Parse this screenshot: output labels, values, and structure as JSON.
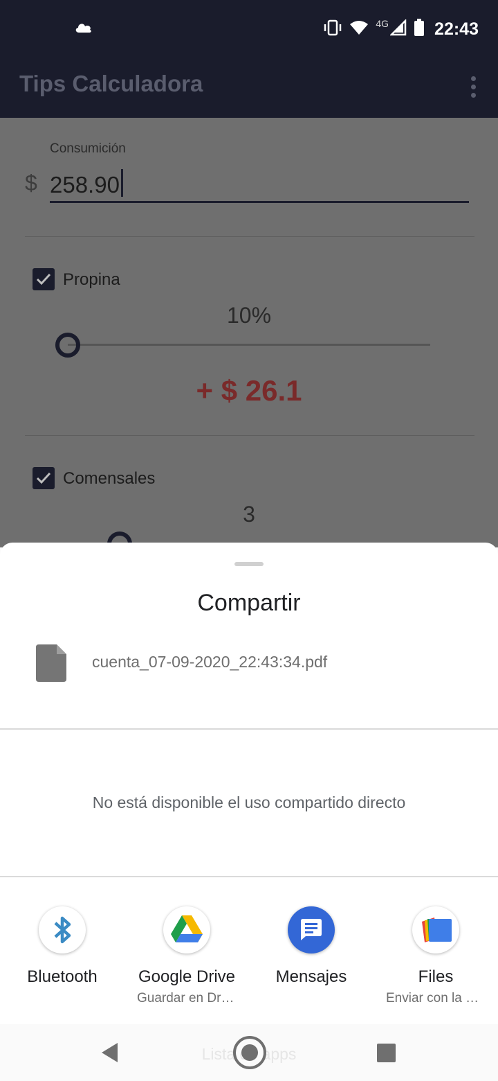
{
  "status_bar": {
    "time": "22:43",
    "network": "4G",
    "icons": [
      "cloud-icon",
      "vibrate-icon",
      "wifi-icon",
      "signal-icon",
      "battery-icon"
    ]
  },
  "app_bar": {
    "title": "Tips Calculadora",
    "menu_icon": "more-vert-icon"
  },
  "form": {
    "consumption_label": "Consumición",
    "currency_symbol": "$",
    "consumption_value": "258.90",
    "tip_label": "Propina",
    "tip_checked": true,
    "tip_percent": "10%",
    "tip_slider_level": 0.0,
    "tip_amount": "+ $ 26.1",
    "diners_label": "Comensales",
    "diners_checked": true,
    "diners_count": "3"
  },
  "share_sheet": {
    "title": "Compartir",
    "file_name": "cuenta_07-09-2020_22:43:34.pdf",
    "no_direct_share": "No está disponible el uso compartido directo",
    "apps": [
      {
        "name": "Bluetooth",
        "subtitle": "",
        "icon": "bluetooth-icon"
      },
      {
        "name": "Google Drive",
        "subtitle": "Guardar en Drive",
        "icon": "google-drive-icon"
      },
      {
        "name": "Mensajes",
        "subtitle": "",
        "icon": "messages-icon"
      },
      {
        "name": "Files",
        "subtitle": "Enviar con la app",
        "icon": "files-icon"
      }
    ]
  },
  "nav_bar": {
    "hint": "Lista de apps",
    "colors": {
      "primary_dark": "#1a1c2c",
      "tip_red": "#7a2a2a",
      "messages_blue": "#3367d6"
    }
  }
}
